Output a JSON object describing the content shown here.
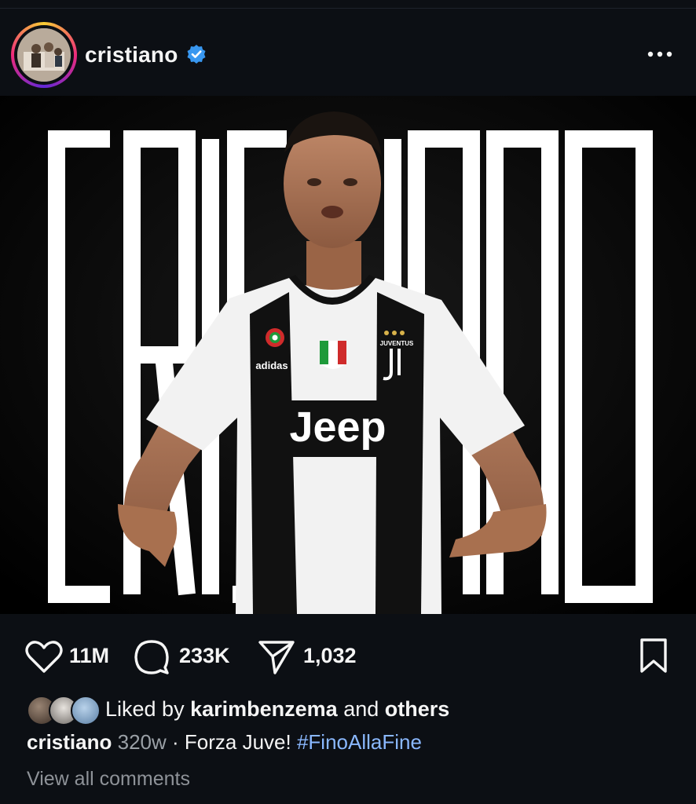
{
  "post": {
    "username": "cristiano",
    "verified": true,
    "more_icon": "more-horizontal-icon"
  },
  "image": {
    "background_text": "CRISTIANO",
    "shirt_brand": "adidas",
    "sponsor": "Jeep",
    "crest_label": "JUVENTUS"
  },
  "actions": {
    "likes": "11M",
    "comments": "233K",
    "shares": "1,032"
  },
  "liked_by": {
    "prefix": "Liked by",
    "user": "karimbenzema",
    "middle": "and",
    "others": "others"
  },
  "caption": {
    "user": "cristiano",
    "time": "320w",
    "separator": "·",
    "text": "Forza Juve!",
    "hashtag": "#FinoAllaFine"
  },
  "comments_link": "View all comments",
  "colors": {
    "background": "#0c0f14",
    "verified": "#3897f0",
    "hashtag": "#8ab8ff",
    "muted": "#8e9298"
  }
}
